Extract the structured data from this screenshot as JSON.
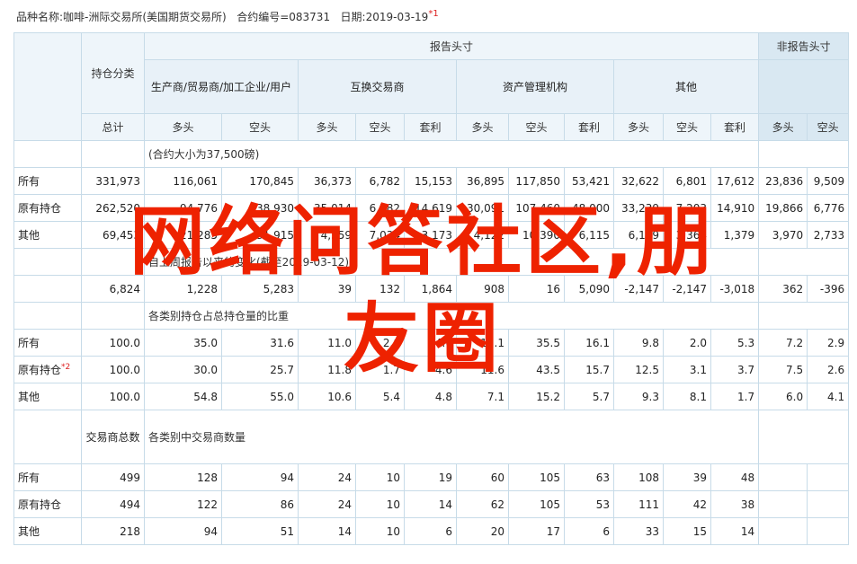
{
  "header": {
    "label_product": "品种名称:",
    "product": "咖啡-洲际交易所(美国期货交易所)",
    "label_code": "合约编号=",
    "code": "083731",
    "label_date": "日期:",
    "date": "2019-03-19",
    "footnote_mark": "*1"
  },
  "columns": {
    "reportable": "报告头寸",
    "nonreportable": "非报告头寸",
    "holding_category": "持仓分类",
    "groups": [
      "生产商/贸易商/加工企业/用户",
      "互换交易商",
      "资产管理机构",
      "其他"
    ],
    "total": "总计",
    "long": "多头",
    "short": "空头",
    "spread": "套利"
  },
  "section_positions": {
    "subtitle": "(合约大小为37,500磅)",
    "rows": [
      {
        "label": "所有",
        "mark": "",
        "values": [
          "331,973",
          "116,061",
          "170,845",
          "36,373",
          "6,782",
          "15,153",
          "36,895",
          "117,850",
          "53,421",
          "32,622",
          "6,801",
          "17,612",
          "23,836",
          "9,509"
        ]
      },
      {
        "label": "原有持仓",
        "mark": "",
        "values": [
          "262,520",
          "94,776",
          "138,930",
          "35,014",
          "6,782",
          "14,619",
          "30,091",
          "107,460",
          "48,000",
          "33,239",
          "7,203",
          "14,910",
          "19,866",
          "6,776"
        ]
      },
      {
        "label": "其他",
        "mark": "",
        "values": [
          "69,453",
          "21,285",
          "31,915",
          "4,559",
          "7,034",
          "3,173",
          "4,122",
          "10,390",
          "6,115",
          "6,159",
          "3,364",
          "1,379",
          "3,970",
          "2,733"
        ]
      }
    ]
  },
  "section_changes": {
    "subtitle": "自上周报告以来的变化(截至2019-03-12)",
    "values": [
      "6,824",
      "1,228",
      "5,283",
      "39",
      "132",
      "1,864",
      "908",
      "16",
      "5,090",
      "-2,147",
      "-2,147",
      "-3,018",
      "362",
      "-396"
    ]
  },
  "section_percent": {
    "subtitle": "各类别持仓占总持仓量的比重",
    "rows": [
      {
        "label": "所有",
        "mark": "",
        "values": [
          "100.0",
          "35.0",
          "31.6",
          "11.0",
          "2.0",
          "4.6",
          "11.1",
          "35.5",
          "16.1",
          "9.8",
          "2.0",
          "5.3",
          "7.2",
          "2.9"
        ]
      },
      {
        "label": "原有持仓",
        "mark": "*2",
        "values": [
          "100.0",
          "30.0",
          "25.7",
          "11.8",
          "1.7",
          "4.6",
          "11.6",
          "43.5",
          "15.7",
          "12.5",
          "3.1",
          "3.7",
          "7.5",
          "2.6"
        ]
      },
      {
        "label": "其他",
        "mark": "",
        "values": [
          "100.0",
          "54.8",
          "55.0",
          "10.6",
          "5.4",
          "4.8",
          "7.1",
          "15.2",
          "5.7",
          "9.3",
          "8.1",
          "1.7",
          "6.0",
          "4.1"
        ]
      }
    ]
  },
  "section_traders": {
    "label": "交易商总数",
    "subtitle": "各类别中交易商数量",
    "rows": [
      {
        "label": "所有",
        "mark": "",
        "values": [
          "499",
          "128",
          "94",
          "24",
          "10",
          "19",
          "60",
          "105",
          "63",
          "108",
          "39",
          "48"
        ]
      },
      {
        "label": "原有持仓",
        "mark": "",
        "values": [
          "494",
          "122",
          "86",
          "24",
          "10",
          "14",
          "62",
          "105",
          "53",
          "111",
          "42",
          "38"
        ]
      },
      {
        "label": "其他",
        "mark": "",
        "values": [
          "218",
          "94",
          "51",
          "14",
          "10",
          "6",
          "20",
          "17",
          "6",
          "33",
          "15",
          "14"
        ]
      }
    ]
  },
  "watermark": {
    "line1": "网络问答社区,朋",
    "line2": "友圈"
  }
}
